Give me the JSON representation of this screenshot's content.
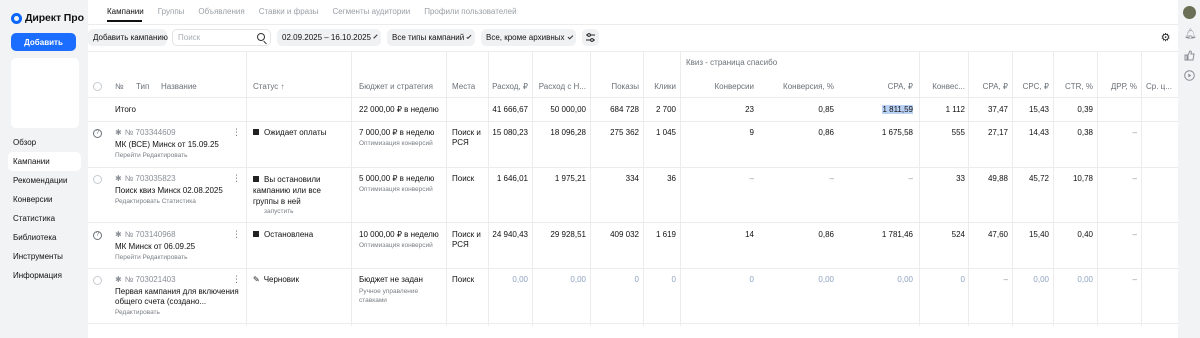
{
  "app": {
    "logo_text": "Директ Про"
  },
  "sidebar": {
    "add_button": "Добавить",
    "items": [
      {
        "label": "Обзор",
        "active": false
      },
      {
        "label": "Кампании",
        "active": true
      },
      {
        "label": "Рекомендации",
        "active": false
      },
      {
        "label": "Конверсии",
        "active": false
      },
      {
        "label": "Статистика",
        "active": false
      },
      {
        "label": "Библиотека",
        "active": false
      },
      {
        "label": "Инструменты",
        "active": false
      },
      {
        "label": "Информация",
        "active": false
      }
    ]
  },
  "tabs": [
    {
      "label": "Кампании",
      "active": true
    },
    {
      "label": "Группы",
      "active": false
    },
    {
      "label": "Объявления",
      "active": false
    },
    {
      "label": "Ставки и фразы",
      "active": false
    },
    {
      "label": "Сегменты аудитории",
      "active": false
    },
    {
      "label": "Профили пользователей",
      "active": false
    }
  ],
  "toolbar": {
    "add_campaign": "Добавить кампанию",
    "search_placeholder": "Поиск",
    "date_range": "02.09.2025 – 16.10.2025",
    "type_filter": "Все типы кампаний",
    "archive_filter": "Все, кроме архивных"
  },
  "table": {
    "group_header": "Квиз - страница спасибо",
    "headers": {
      "num": "№",
      "type": "Тип",
      "name": "Название",
      "status": "Статус ↑",
      "budget": "Бюджет и стратегия",
      "places": "Места",
      "spend": "Расход, ₽",
      "spend_vat": "Расход с Н...",
      "impressions": "Показы",
      "clicks": "Клики",
      "conversions": "Конверсии",
      "conv_rate": "Конверсия, %",
      "cpa": "CPA, ₽",
      "conv2": "Конвес...",
      "cpa2": "CPA, ₽",
      "cpc": "CPC, ₽",
      "ctr": "CTR, %",
      "drr": "ДРР, %",
      "avg": "Ср. ц..."
    },
    "total": {
      "label": "Итого",
      "budget": "22 000,00 ₽ в неделю",
      "spend": "41 666,67",
      "spend_vat": "50 000,00",
      "impressions": "684 728",
      "clicks": "2 700",
      "conversions": "23",
      "conv_rate": "0,85",
      "cpa": "1 811,59",
      "conv2": "1 112",
      "cpa2": "37,47",
      "cpc": "15,43",
      "ctr": "0,39"
    },
    "rows": [
      {
        "id": "№ 703344609",
        "name": "МК (ВСЕ) Минск от 15.09.25",
        "links": "Перейти  Редактировать",
        "status": "Ожидает оплаты",
        "budget": "7 000,00 ₽ в неделю",
        "strategy": "Оптимизация конверсий",
        "places": "Поиск и РСЯ",
        "spend": "15 080,23",
        "spend_vat": "18 096,28",
        "impressions": "275 362",
        "clicks": "1 045",
        "conversions": "9",
        "conv_rate": "0,86",
        "cpa": "1 675,58",
        "conv2": "555",
        "cpa2": "27,17",
        "cpc": "14,43",
        "ctr": "0,38",
        "drr": "–"
      },
      {
        "id": "№ 703035823",
        "name": "Поиск квиз Минск 02.08.2025",
        "links": "Редактировать  Статистика",
        "status": "Вы остановили кампанию или все группы в ней",
        "status_sub": "запустить",
        "budget": "5 000,00 ₽ в неделю",
        "strategy": "Оптимизация конверсий",
        "places": "Поиск",
        "spend": "1 646,01",
        "spend_vat": "1 975,21",
        "impressions": "334",
        "clicks": "36",
        "conversions": "–",
        "conv_rate": "–",
        "cpa": "–",
        "conv2": "33",
        "cpa2": "49,88",
        "cpc": "45,72",
        "ctr": "10,78",
        "drr": "–"
      },
      {
        "id": "№ 703140968",
        "name": "МК Минск от 06.09.25",
        "links": "Перейти  Редактировать",
        "status": "Остановлена",
        "budget": "10 000,00 ₽ в неделю",
        "strategy": "Оптимизация конверсий",
        "places": "Поиск и РСЯ",
        "spend": "24 940,43",
        "spend_vat": "29 928,51",
        "impressions": "409 032",
        "clicks": "1 619",
        "conversions": "14",
        "conv_rate": "0,86",
        "cpa": "1 781,46",
        "conv2": "524",
        "cpa2": "47,60",
        "cpc": "15,40",
        "ctr": "0,40",
        "drr": "–"
      },
      {
        "id": "№ 703021403",
        "name": "Первая кампания для включения общего счета (создано...",
        "links": "Редактировать",
        "status": "Черновик",
        "budget": "Бюджет не задан",
        "strategy": "Ручное управление ставками",
        "places": "Поиск",
        "spend": "0,00",
        "spend_vat": "0,00",
        "impressions": "0",
        "clicks": "0",
        "conversions": "0",
        "conv_rate": "0,00",
        "cpa": "0,00",
        "conv2": "0",
        "cpa2": "–",
        "cpc": "0,00",
        "ctr": "0,00",
        "drr": "–"
      }
    ]
  },
  "icons": {
    "logo": "direct-logo-icon",
    "search": "search-icon",
    "filter": "filter-settings-icon",
    "gear": "gear-icon",
    "avatar": "avatar",
    "bell": "bell-icon",
    "thumb": "thumb-up-icon",
    "play": "play-icon"
  }
}
